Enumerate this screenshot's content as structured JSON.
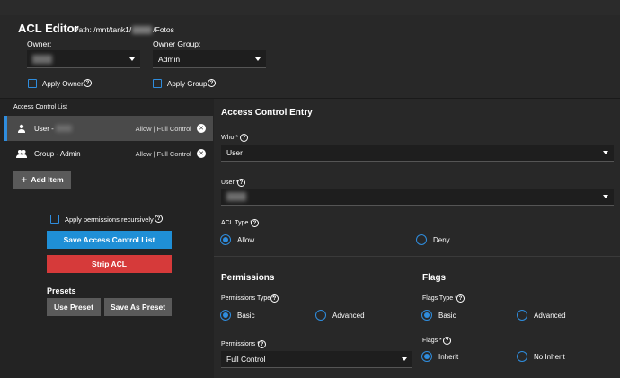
{
  "header": {
    "title": "ACL Editor",
    "path_prefix": "Path:  /mnt/tank1/",
    "path_suffix": "/Fotos",
    "owner_label": "Owner:",
    "owner_group_label": "Owner Group:",
    "owner_group_value": "Admin",
    "apply_owner_label": "Apply Owner",
    "apply_group_label": "Apply Group"
  },
  "acl": {
    "title": "Access Control List",
    "entries": [
      {
        "name": "User - ",
        "perm": "Allow | Full Control"
      },
      {
        "name": "Group - Admin",
        "perm": "Allow | Full Control"
      }
    ],
    "add_item_label": "Add Item",
    "recursive_label": "Apply permissions recursively",
    "save_label": "Save Access Control List",
    "strip_label": "Strip ACL",
    "presets_title": "Presets",
    "use_preset_label": "Use Preset",
    "save_preset_label": "Save As Preset"
  },
  "entry": {
    "title": "Access Control Entry",
    "who_label": "Who *",
    "who_value": "User",
    "user_label": "User *",
    "acl_type_label": "ACL Type *",
    "allow_label": "Allow",
    "deny_label": "Deny"
  },
  "permissions": {
    "title": "Permissions",
    "type_label": "Permissions Type *",
    "basic_label": "Basic",
    "advanced_label": "Advanced",
    "perm_label": "Permissions *",
    "perm_value": "Full Control"
  },
  "flags": {
    "title": "Flags",
    "type_label": "Flags Type *",
    "basic_label": "Basic",
    "advanced_label": "Advanced",
    "flags_label": "Flags *",
    "inherit_label": "Inherit",
    "no_inherit_label": "No Inherit"
  },
  "colors": {
    "accent": "#2f8dde",
    "save_button": "#1f8fd6",
    "strip_button": "#d63a3a",
    "neutral_button": "#5a5a5a"
  }
}
